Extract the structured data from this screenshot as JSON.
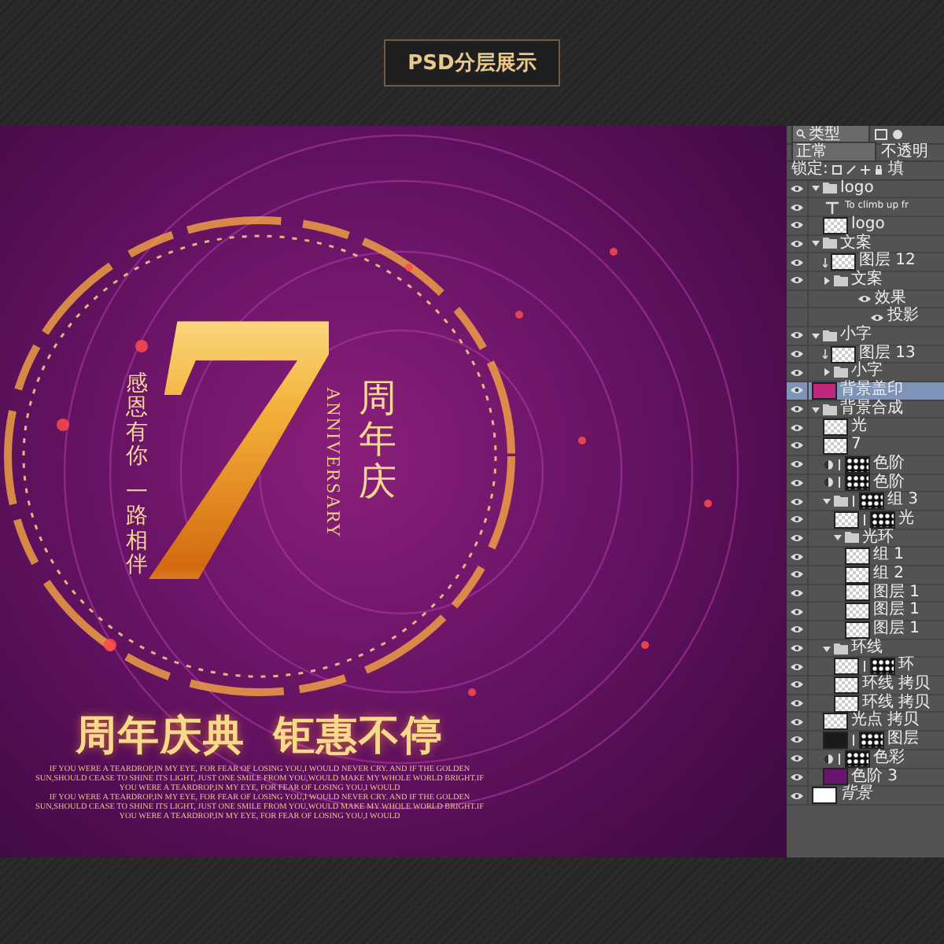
{
  "header": {
    "title": "PSD分层展示"
  },
  "poster": {
    "numeral": "7",
    "side_text": [
      "感恩有你",
      "一路相伴"
    ],
    "title_vertical": "周年庆",
    "anniversary": "ANNIVERSARY",
    "headline": [
      "周年庆典",
      "钜惠不停"
    ],
    "body_lines": [
      "IF YOU WERE A TEARDROP,IN MY EYE,  FOR FEAR OF LOSING YOU,I WOULD NEVER CRY.  AND IF THE GOLDEN",
      "SUN,SHOULD CEASE TO SHINE ITS LIGHT,  JUST ONE SMILE FROM YOU,WOULD MAKE MY WHOLE WORLD BRIGHT.IF",
      "YOU WERE A TEARDROP,IN MY EYE,  FOR FEAR OF LOSING YOU,I WOULD",
      "IF YOU WERE A TEARDROP,IN MY EYE,  FOR FEAR OF LOSING YOU,I WOULD NEVER CRY.  AND IF THE GOLDEN",
      "SUN,SHOULD CEASE TO SHINE ITS LIGHT,  JUST ONE SMILE FROM YOU,WOULD MAKE MY WHOLE WORLD BRIGHT.IF",
      "YOU WERE A TEARDROP,IN MY EYE,  FOR FEAR OF LOSING YOU,I WOULD"
    ]
  },
  "layers_panel": {
    "filter": {
      "value": "类型"
    },
    "blend_mode": {
      "value": "正常"
    },
    "opacity_label": "不透明",
    "lock_label": "锁定:",
    "fill_label": "填",
    "layers": [
      {
        "kind": "group",
        "name": "logo",
        "expanded": true,
        "selected": false,
        "children": [
          {
            "kind": "text",
            "name": "To climb up fr",
            "selected": false
          },
          {
            "kind": "layer",
            "name": "logo",
            "selected": false
          }
        ]
      },
      {
        "kind": "group",
        "name": "文案",
        "expanded": true,
        "selected": false,
        "children": [
          {
            "kind": "layer",
            "name": "图层 12",
            "clipped": true,
            "selected": false
          },
          {
            "kind": "group",
            "name": "文案",
            "expanded": false,
            "selected": false,
            "effects_label": "效果",
            "effects": [
              "投影"
            ]
          }
        ]
      },
      {
        "kind": "group",
        "name": "小字",
        "expanded": true,
        "selected": false,
        "children": [
          {
            "kind": "layer",
            "name": "图层 13",
            "clipped": true,
            "selected": false
          },
          {
            "kind": "group",
            "name": "小字",
            "expanded": false,
            "selected": false
          }
        ]
      },
      {
        "kind": "layer",
        "name": "背景盖印",
        "color": "#c0287e",
        "selected": true
      },
      {
        "kind": "group",
        "name": "背景合成",
        "expanded": true,
        "selected": false,
        "children": [
          {
            "kind": "layer",
            "name": "光",
            "selected": false
          },
          {
            "kind": "layer",
            "name": "7",
            "selected": false
          },
          {
            "kind": "adjustment",
            "name": "色阶",
            "mask": true,
            "selected": false
          },
          {
            "kind": "adjustment",
            "name": "色阶",
            "mask": true,
            "selected": false
          },
          {
            "kind": "group",
            "name": "组 3",
            "expanded": true,
            "mask": true,
            "selected": false,
            "children": [
              {
                "kind": "layer",
                "name": "光",
                "mask": true,
                "selected": false
              },
              {
                "kind": "group",
                "name": "光环",
                "expanded": true,
                "selected": false,
                "children": [
                  {
                    "kind": "layer",
                    "name": "组 1",
                    "selected": false
                  },
                  {
                    "kind": "layer",
                    "name": "组 2",
                    "selected": false
                  },
                  {
                    "kind": "layer",
                    "name": "图层 1",
                    "selected": false
                  },
                  {
                    "kind": "layer",
                    "name": "图层 1",
                    "selected": false
                  },
                  {
                    "kind": "layer",
                    "name": "图层 1",
                    "selected": false
                  }
                ]
              }
            ]
          },
          {
            "kind": "group",
            "name": "环线",
            "expanded": true,
            "selected": false,
            "children": [
              {
                "kind": "layer",
                "name": "环",
                "mask": true,
                "selected": false
              },
              {
                "kind": "layer",
                "name": "环线 拷贝",
                "selected": false
              },
              {
                "kind": "layer",
                "name": "环线 拷贝",
                "selected": false
              }
            ]
          },
          {
            "kind": "layer",
            "name": "光点 拷贝",
            "selected": false
          },
          {
            "kind": "layer",
            "name": "图层",
            "color": "#1a1a1a",
            "mask": true,
            "selected": false
          },
          {
            "kind": "adjustment",
            "name": "色彩",
            "mask": true,
            "selected": false
          },
          {
            "kind": "layer",
            "name": "色阶 3",
            "color": "#6a1470",
            "selected": false
          }
        ]
      },
      {
        "kind": "layer",
        "name": "背景",
        "color": "#ffffff",
        "locked": true,
        "selected": false
      }
    ]
  }
}
